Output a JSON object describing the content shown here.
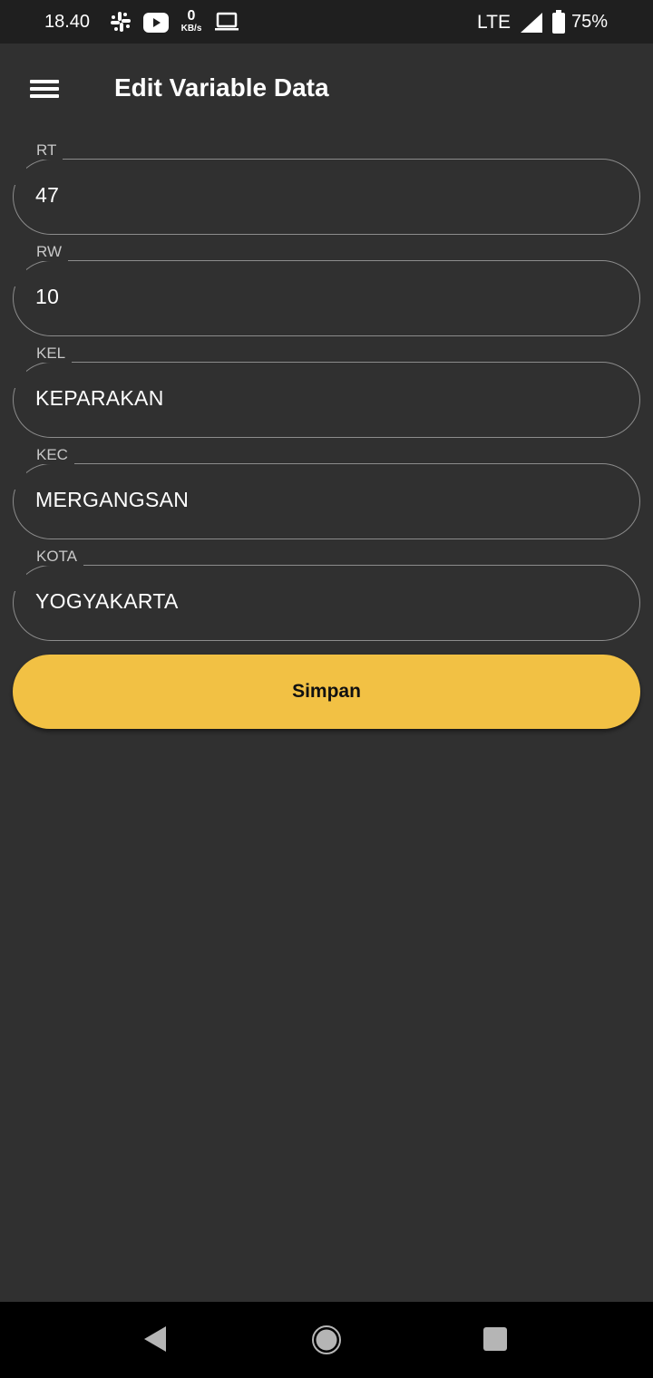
{
  "status_bar": {
    "time": "18.40",
    "net_speed": "0",
    "net_unit": "KB/s",
    "network": "LTE",
    "battery": "75%",
    "icons": [
      "slack-icon",
      "youtube-icon",
      "laptop-icon",
      "signal-icon",
      "battery-icon"
    ]
  },
  "app_bar": {
    "title": "Edit Variable Data",
    "menu_icon": "hamburger-menu-icon"
  },
  "form": {
    "fields": [
      {
        "label": "RT",
        "value": "47"
      },
      {
        "label": "RW",
        "value": "10"
      },
      {
        "label": "KEL",
        "value": "KEPARAKAN"
      },
      {
        "label": "KEC",
        "value": "MERGANGSAN"
      },
      {
        "label": "KOTA",
        "value": "YOGYAKARTA"
      }
    ],
    "save_label": "Simpan"
  },
  "nav_bar": {
    "icons": [
      "back-icon",
      "home-icon",
      "recent-apps-icon"
    ]
  },
  "colors": {
    "background": "#303030",
    "status_bar": "#1f1f1f",
    "accent": "#f2c144",
    "outline": "#8c8c8c",
    "nav_bar": "#000000"
  }
}
